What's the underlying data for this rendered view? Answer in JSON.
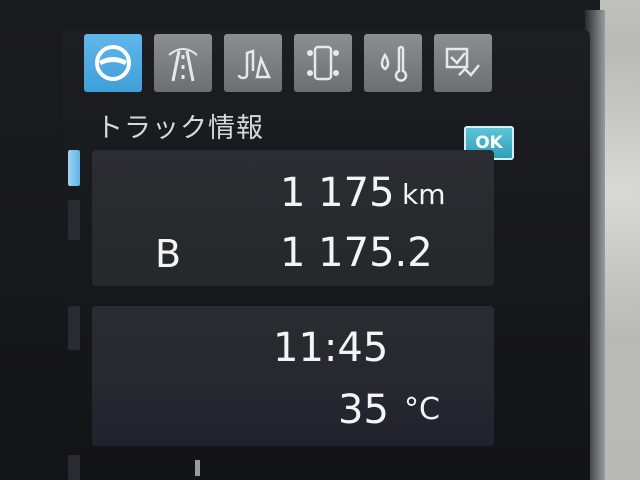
{
  "header": {
    "title": "トラック情報",
    "ok_label": "OK"
  },
  "tabs": [
    {
      "name": "steering-wheel-icon",
      "active": true
    },
    {
      "name": "road-lanes-icon",
      "active": false
    },
    {
      "name": "music-bell-icon",
      "active": false
    },
    {
      "name": "truck-axles-icon",
      "active": false
    },
    {
      "name": "drop-thermometer-icon",
      "active": false
    },
    {
      "name": "settings-check-icon",
      "active": false
    }
  ],
  "odometer": {
    "value": "1 175",
    "unit": "km"
  },
  "trip": {
    "label": "B",
    "value": "1 175.2"
  },
  "clock": {
    "time": "11:45"
  },
  "temperature": {
    "value": "35",
    "unit": "°C"
  },
  "colors": {
    "active_tab": "#4aa8dd",
    "ok_button": "#3aafc7",
    "text": "#f4f4f4"
  }
}
